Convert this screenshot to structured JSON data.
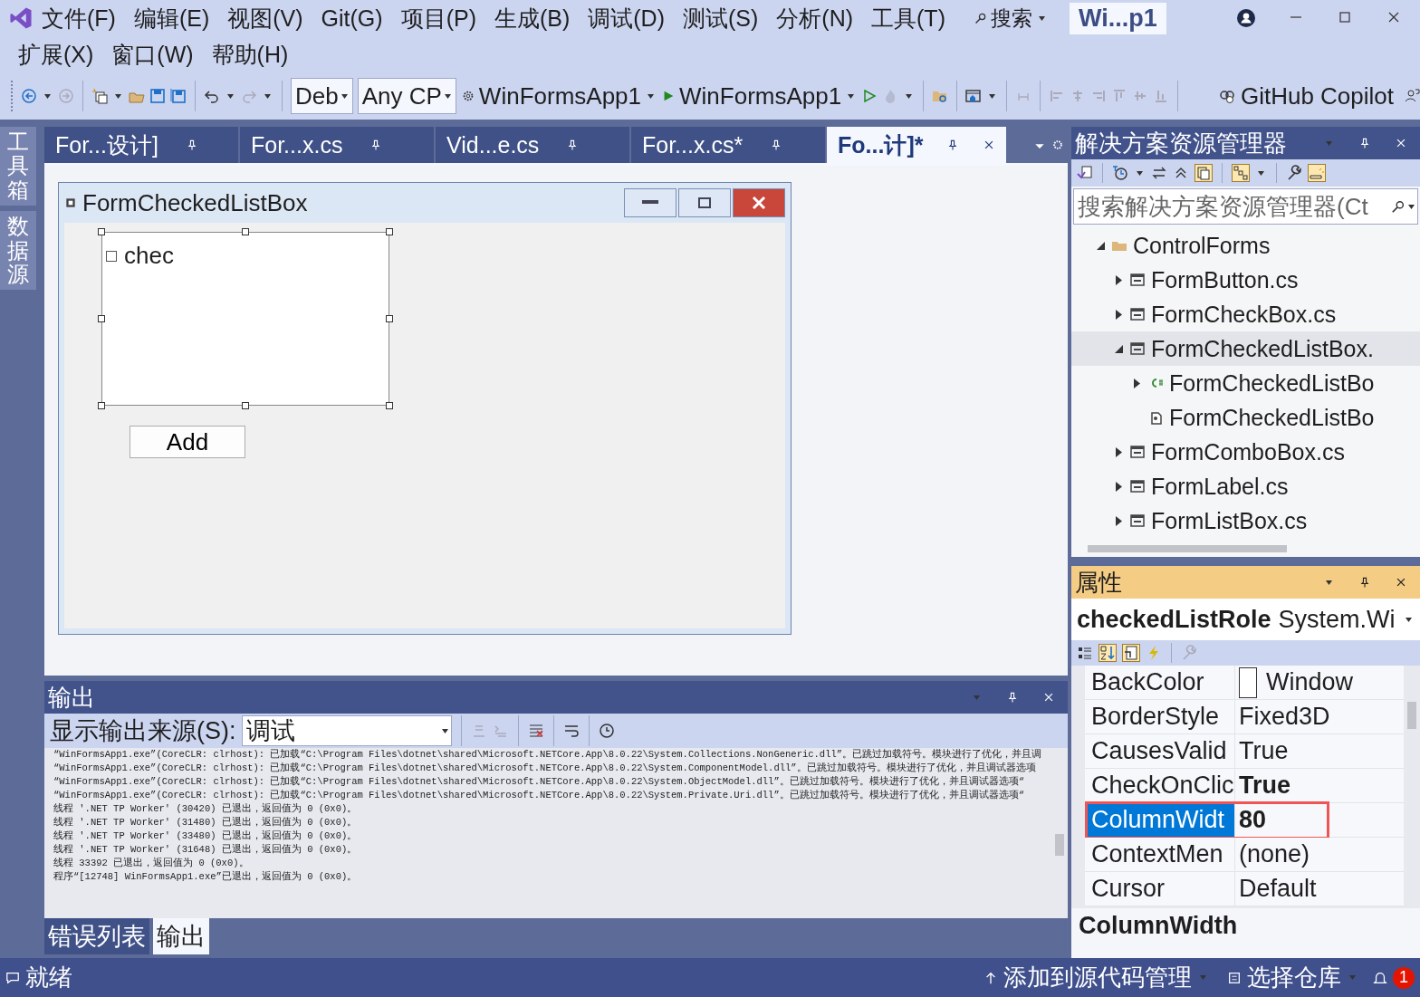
{
  "menu_bar": {
    "items": [
      {
        "label": "文件(F)"
      },
      {
        "label": "编辑(E)"
      },
      {
        "label": "视图(V)"
      },
      {
        "label": "Git(G)"
      },
      {
        "label": "项目(P)"
      },
      {
        "label": "生成(B)"
      },
      {
        "label": "调试(D)"
      },
      {
        "label": "测试(S)"
      },
      {
        "label": "分析(N)"
      },
      {
        "label": "工具(T)"
      }
    ],
    "search": "搜索",
    "solution_name": "Wi...p1",
    "second_row": [
      {
        "label": "扩展(X)"
      },
      {
        "label": "窗口(W)"
      },
      {
        "label": "帮助(H)"
      }
    ]
  },
  "toolbar": {
    "configuration": "Deb",
    "platform": "Any CP",
    "startup_project": "WinFormsApp1",
    "run_target": "WinFormsApp1",
    "copilot": "GitHub Copilot"
  },
  "side_tabs": [
    {
      "label": "工具箱"
    },
    {
      "label": "数据源"
    }
  ],
  "document_tabs": [
    {
      "label": "For...设计]",
      "selected": false
    },
    {
      "label": "For...x.cs",
      "selected": false
    },
    {
      "label": "Vid...e.cs",
      "selected": false
    },
    {
      "label": "For...x.cs*",
      "selected": false
    },
    {
      "label": "Fo...计]*",
      "selected": true
    }
  ],
  "designer": {
    "form_title": "FormCheckedListBox",
    "listbox_items": [
      {
        "label": "chec",
        "checked": false
      }
    ],
    "button": "Add"
  },
  "output": {
    "title": "输出",
    "source_label": "显示输出来源(S):",
    "source": "调试",
    "lines": [
      "“WinFormsApp1.exe”(CoreCLR: clrhost): 已加载“C:\\Program Files\\dotnet\\shared\\Microsoft.NETCore.App\\8.0.22\\System.Collections.NonGeneric.dll”。已跳过加载符号。模块进行了优化，并且调",
      "“WinFormsApp1.exe”(CoreCLR: clrhost): 已加载“C:\\Program Files\\dotnet\\shared\\Microsoft.NETCore.App\\8.0.22\\System.ComponentModel.dll”。已跳过加载符号。模块进行了优化，并且调试器选项",
      "“WinFormsApp1.exe”(CoreCLR: clrhost): 已加载“C:\\Program Files\\dotnet\\shared\\Microsoft.NETCore.App\\8.0.22\\System.ObjectModel.dll”。已跳过加载符号。模块进行了优化，并且调试器选项“",
      "“WinFormsApp1.exe”(CoreCLR: clrhost): 已加载“C:\\Program Files\\dotnet\\shared\\Microsoft.NETCore.App\\8.0.22\\System.Private.Uri.dll”。已跳过加载符号。模块进行了优化，并且调试器选项“",
      "线程 '.NET TP Worker' (30420) 已退出，返回值为 0 (0x0)。",
      "线程 '.NET TP Worker' (31480) 已退出，返回值为 0 (0x0)。",
      "线程 '.NET TP Worker' (33480) 已退出，返回值为 0 (0x0)。",
      "线程 '.NET TP Worker' (31648) 已退出，返回值为 0 (0x0)。",
      "线程 33392 已退出，返回值为 0 (0x0)。",
      "程序“[12748] WinFormsApp1.exe”已退出，返回值为 0 (0x0)。"
    ]
  },
  "bottom_tabs": [
    {
      "label": "错误列表",
      "selected": false
    },
    {
      "label": "输出",
      "selected": true
    }
  ],
  "solution_explorer": {
    "title": "解决方案资源管理器",
    "search_placeholder": "搜索解决方案资源管理器(Ct",
    "tree": [
      {
        "label": "ControlForms",
        "kind": "folder",
        "expanded": true,
        "selected": false,
        "children": [
          {
            "label": "FormButton.cs",
            "kind": "form",
            "expanded": false,
            "selected": false
          },
          {
            "label": "FormCheckBox.cs",
            "kind": "form",
            "expanded": false,
            "selected": false
          },
          {
            "label": "FormCheckedListBox.",
            "kind": "form",
            "expanded": true,
            "selected": true,
            "children": [
              {
                "label": "FormCheckedListBo",
                "kind": "csharp",
                "expanded": false,
                "selected": false
              },
              {
                "label": "FormCheckedListBo",
                "kind": "resource",
                "selected": false
              }
            ]
          },
          {
            "label": "FormComboBox.cs",
            "kind": "form",
            "expanded": false,
            "selected": false
          },
          {
            "label": "FormLabel.cs",
            "kind": "form",
            "expanded": false,
            "selected": false
          },
          {
            "label": "FormListBox.cs",
            "kind": "form",
            "expanded": false,
            "selected": false
          }
        ]
      }
    ]
  },
  "properties": {
    "title": "属性",
    "object_name": "checkedListRole",
    "object_type": "System.Wi",
    "rows": [
      {
        "name": "BackColor",
        "value": "Window",
        "kind": "color",
        "bold": false,
        "selected": false,
        "highlighted": false
      },
      {
        "name": "BorderStyle",
        "value": "Fixed3D",
        "kind": "text",
        "bold": false,
        "selected": false,
        "highlighted": false
      },
      {
        "name": "CausesValid",
        "value": "True",
        "kind": "text",
        "bold": false,
        "selected": false,
        "highlighted": false
      },
      {
        "name": "CheckOnClic",
        "value": "True",
        "kind": "text",
        "bold": true,
        "selected": false,
        "highlighted": false
      },
      {
        "name": "ColumnWidt",
        "value": "80",
        "kind": "text",
        "bold": true,
        "selected": true,
        "highlighted": true
      },
      {
        "name": "ContextMen",
        "value": "(none)",
        "kind": "text",
        "bold": false,
        "selected": false,
        "highlighted": false
      },
      {
        "name": "Cursor",
        "value": "Default",
        "kind": "text",
        "bold": false,
        "selected": false,
        "highlighted": false
      }
    ],
    "description_title": "ColumnWidth"
  },
  "status_bar": {
    "status": "就绪",
    "source_control": "添加到源代码管理",
    "repository": "选择仓库",
    "notifications": "1"
  }
}
